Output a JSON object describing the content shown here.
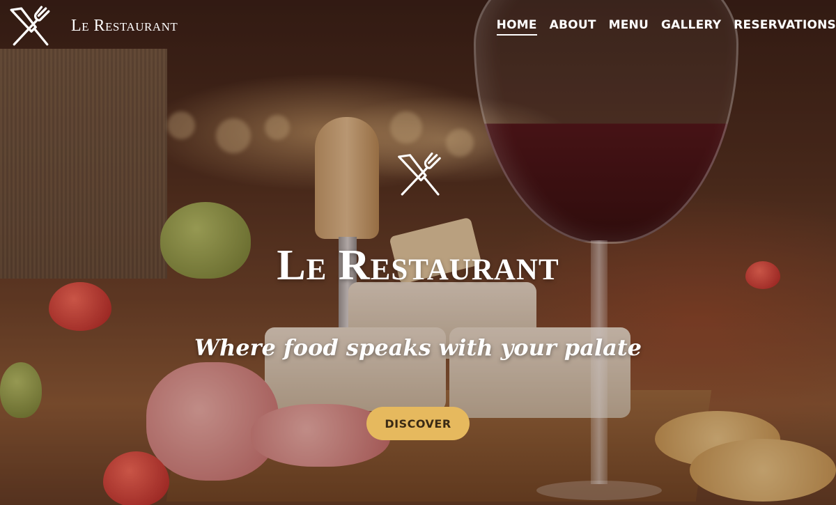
{
  "brand": {
    "name": "Le Restaurant",
    "logo_icon": "fork-knife-icon"
  },
  "nav": {
    "items": [
      {
        "label": "HOME",
        "active": true
      },
      {
        "label": "ABOUT",
        "active": false
      },
      {
        "label": "MENU",
        "active": false
      },
      {
        "label": "GALLERY",
        "active": false
      },
      {
        "label": "RESERVATIONS",
        "active": false
      }
    ]
  },
  "hero": {
    "icon": "fork-knife-icon",
    "title": "Le Restaurant",
    "subtitle": "Where food speaks with your palate",
    "cta_label": "DISCOVER",
    "background_image": "charcuterie board with cheese, prosciutto, crackers and a glass of red wine"
  },
  "colors": {
    "accent": "#e6b95e",
    "text": "#ffffff",
    "cta_text": "#3a2a14"
  }
}
